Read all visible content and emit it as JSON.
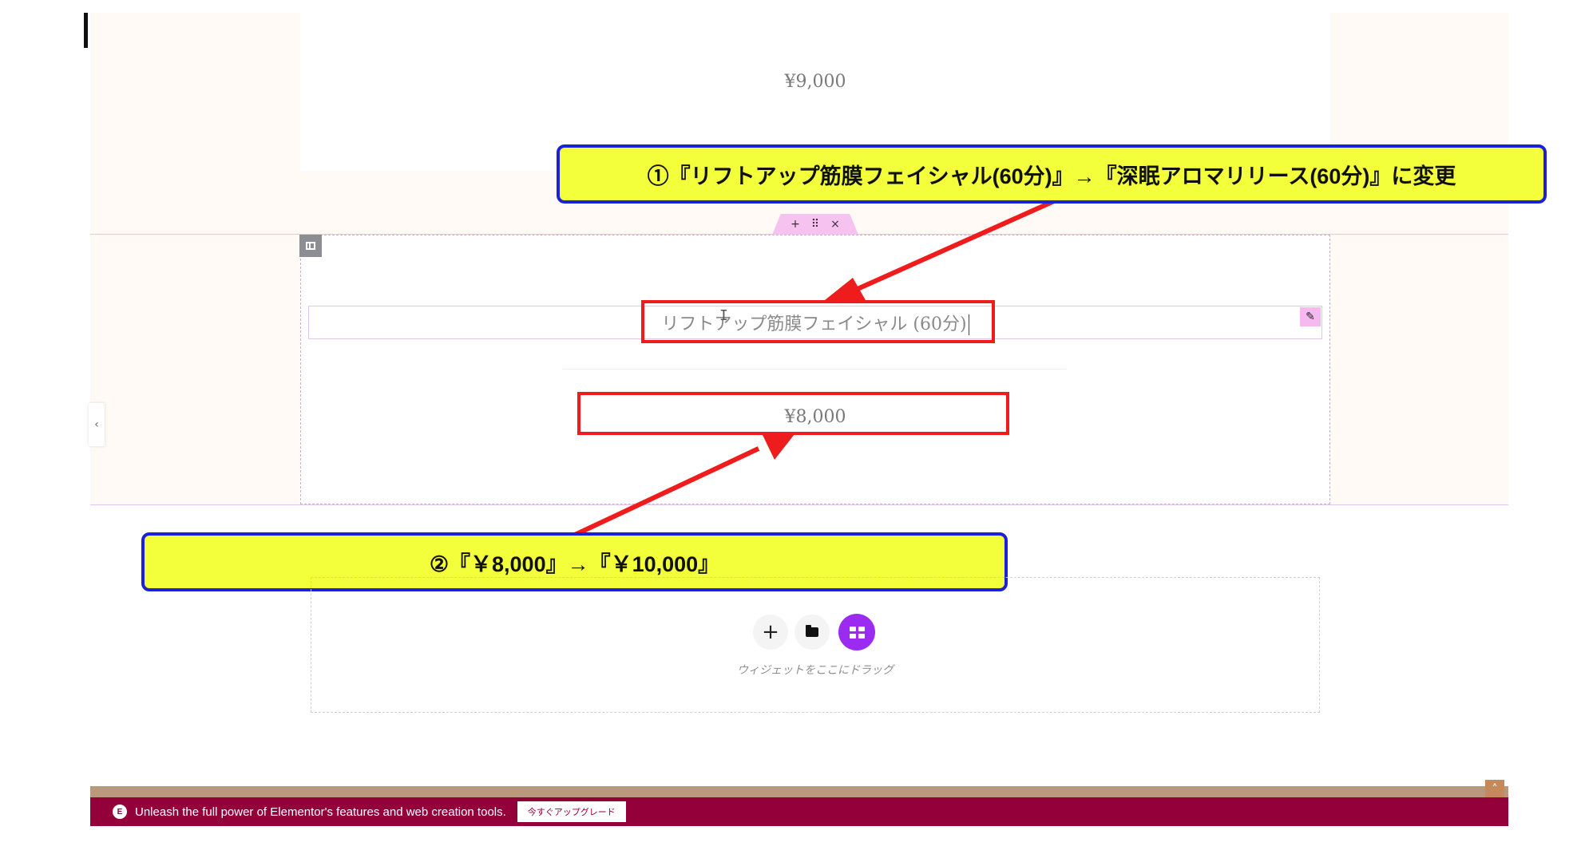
{
  "canvas": {
    "top_price": "¥9,000",
    "section_handle": {
      "add": "+",
      "move": "⠿",
      "close": "×"
    },
    "heading_text": "リフトアップ筋膜フェイシャル (60分)",
    "price_text": "¥8,000",
    "collapse_glyph": "‹",
    "edit_glyph": "✎"
  },
  "annotations": {
    "callout_1": "①『リフトアップ筋膜フェイシャル(60分)』→『深眠アロマリリース(60分)』に変更",
    "callout_2": "②『￥8,000』→『￥10,000』"
  },
  "empty_container": {
    "add_glyph": "+",
    "drop_label": "ウィジェットをここにドラッグ"
  },
  "promo": {
    "icon_text": "E",
    "text": "Unleash the full power of Elementor's features and web creation tools.",
    "button": "今すぐアップグレード",
    "scroll_glyph": "˄"
  },
  "colors": {
    "accent_pink": "#f6c3f0",
    "annotation_red": "#ee1c1c",
    "callout_yellow": "#f2ff3a",
    "callout_border": "#1b22d6",
    "promo_bg": "#93003a",
    "kit_purple": "#9b2bf0"
  }
}
